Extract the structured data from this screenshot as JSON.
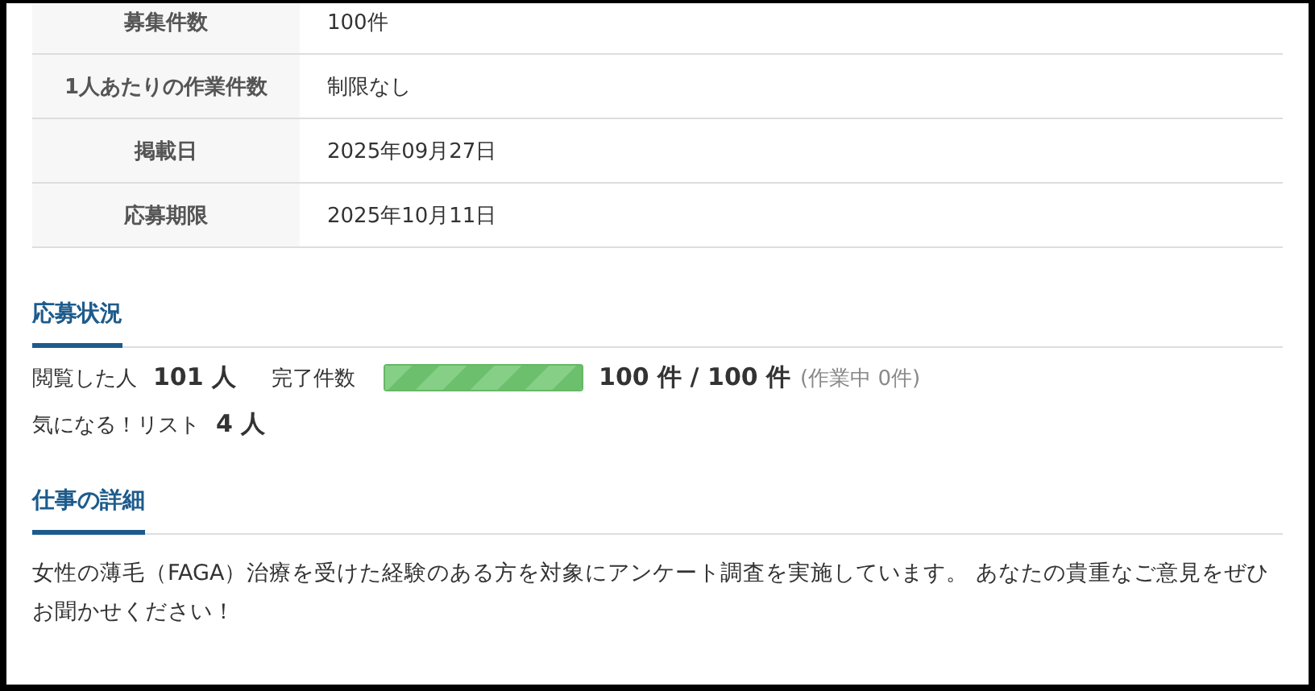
{
  "details_table": {
    "rows": [
      {
        "label": "募集件数",
        "value": "100件"
      },
      {
        "label": "1人あたりの作業件数",
        "value": "制限なし"
      },
      {
        "label": "掲載日",
        "value": "2025年09月27日"
      },
      {
        "label": "応募期限",
        "value": "2025年10月11日"
      }
    ]
  },
  "application_status": {
    "title": "応募状況",
    "viewed_label": "閲覧した人",
    "viewed_count": "101 人",
    "completed_label": "完了件数",
    "progress": {
      "level": 1
    },
    "completed_count": "100 件 / 100 件",
    "in_progress": "(作業中 0件)",
    "favorites_label": "気になる！リスト",
    "favorites_count": "4 人"
  },
  "job_details": {
    "title": "仕事の詳細",
    "description": "女性の薄毛（FAGA）治療を受けた経験のある方を対象にアンケート調査を実施しています。 あなたの貴重なご意見をぜひお聞かせください！"
  }
}
